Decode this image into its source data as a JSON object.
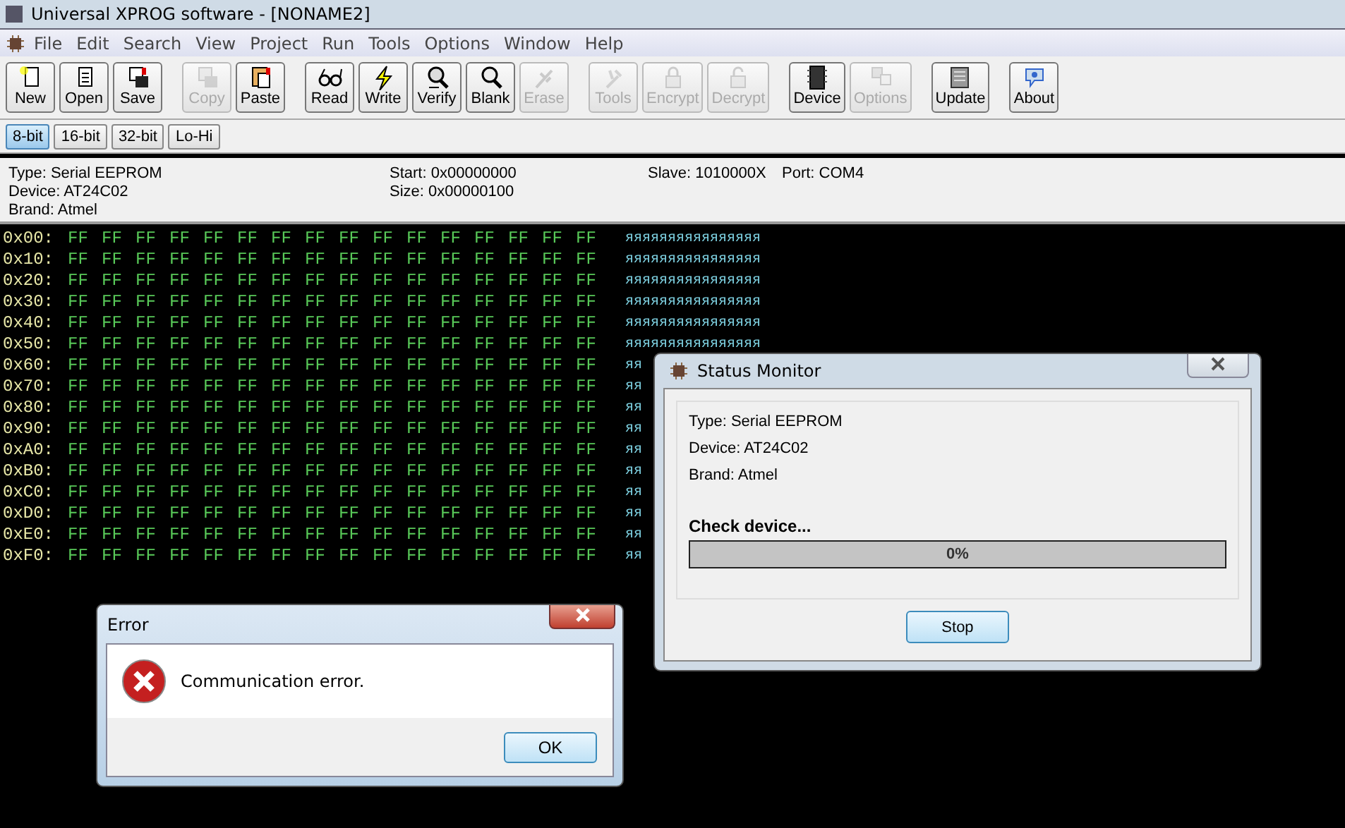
{
  "window": {
    "title": "Universal XPROG software - [NONAME2]"
  },
  "menu": [
    "File",
    "Edit",
    "Search",
    "View",
    "Project",
    "Run",
    "Tools",
    "Options",
    "Window",
    "Help"
  ],
  "toolbar": [
    [
      {
        "label": "New",
        "disabled": false
      },
      {
        "label": "Open",
        "disabled": false
      },
      {
        "label": "Save",
        "disabled": false
      }
    ],
    [
      {
        "label": "Copy",
        "disabled": true
      },
      {
        "label": "Paste",
        "disabled": false
      }
    ],
    [
      {
        "label": "Read",
        "disabled": false
      },
      {
        "label": "Write",
        "disabled": false
      },
      {
        "label": "Verify",
        "disabled": false
      },
      {
        "label": "Blank",
        "disabled": false
      },
      {
        "label": "Erase",
        "disabled": true
      }
    ],
    [
      {
        "label": "Tools",
        "disabled": true
      },
      {
        "label": "Encrypt",
        "disabled": true
      },
      {
        "label": "Decrypt",
        "disabled": true
      }
    ],
    [
      {
        "label": "Device",
        "disabled": false
      },
      {
        "label": "Options",
        "disabled": true
      }
    ],
    [
      {
        "label": "Update",
        "disabled": false
      }
    ],
    [
      {
        "label": "About",
        "disabled": false
      }
    ]
  ],
  "bit_tabs": [
    {
      "label": "8-bit",
      "selected": true
    },
    {
      "label": "16-bit",
      "selected": false
    },
    {
      "label": "32-bit",
      "selected": false
    },
    {
      "label": "Lo-Hi",
      "selected": false
    }
  ],
  "info": {
    "column_1": [
      "Type: Serial EEPROM",
      "Device: AT24C02",
      "Brand: Atmel"
    ],
    "column_2": [
      "Start: 0x00000000",
      "Size: 0x00000100"
    ],
    "column_3": [
      "Slave: 1010000X"
    ],
    "column_4": [
      "Port: COM4"
    ]
  },
  "hex_rows": [
    {
      "address": "0x00:",
      "bytes": [
        "FF",
        "FF",
        "FF",
        "FF",
        "FF",
        "FF",
        "FF",
        "FF",
        "FF",
        "FF",
        "FF",
        "FF",
        "FF",
        "FF",
        "FF",
        "FF"
      ],
      "ascii": "яяяяяяяяяяяяяяяя"
    },
    {
      "address": "0x10:",
      "bytes": [
        "FF",
        "FF",
        "FF",
        "FF",
        "FF",
        "FF",
        "FF",
        "FF",
        "FF",
        "FF",
        "FF",
        "FF",
        "FF",
        "FF",
        "FF",
        "FF"
      ],
      "ascii": "яяяяяяяяяяяяяяяя"
    },
    {
      "address": "0x20:",
      "bytes": [
        "FF",
        "FF",
        "FF",
        "FF",
        "FF",
        "FF",
        "FF",
        "FF",
        "FF",
        "FF",
        "FF",
        "FF",
        "FF",
        "FF",
        "FF",
        "FF"
      ],
      "ascii": "яяяяяяяяяяяяяяяя"
    },
    {
      "address": "0x30:",
      "bytes": [
        "FF",
        "FF",
        "FF",
        "FF",
        "FF",
        "FF",
        "FF",
        "FF",
        "FF",
        "FF",
        "FF",
        "FF",
        "FF",
        "FF",
        "FF",
        "FF"
      ],
      "ascii": "яяяяяяяяяяяяяяяя"
    },
    {
      "address": "0x40:",
      "bytes": [
        "FF",
        "FF",
        "FF",
        "FF",
        "FF",
        "FF",
        "FF",
        "FF",
        "FF",
        "FF",
        "FF",
        "FF",
        "FF",
        "FF",
        "FF",
        "FF"
      ],
      "ascii": "яяяяяяяяяяяяяяяя"
    },
    {
      "address": "0x50:",
      "bytes": [
        "FF",
        "FF",
        "FF",
        "FF",
        "FF",
        "FF",
        "FF",
        "FF",
        "FF",
        "FF",
        "FF",
        "FF",
        "FF",
        "FF",
        "FF",
        "FF"
      ],
      "ascii": "яяяяяяяяяяяяяяяя"
    },
    {
      "address": "0x60:",
      "bytes": [
        "FF",
        "FF",
        "FF",
        "FF",
        "FF",
        "FF",
        "FF",
        "FF",
        "FF",
        "FF",
        "FF",
        "FF",
        "FF",
        "FF",
        "FF",
        "FF"
      ],
      "ascii": "яя"
    },
    {
      "address": "0x70:",
      "bytes": [
        "FF",
        "FF",
        "FF",
        "FF",
        "FF",
        "FF",
        "FF",
        "FF",
        "FF",
        "FF",
        "FF",
        "FF",
        "FF",
        "FF",
        "FF",
        "FF"
      ],
      "ascii": "яя"
    },
    {
      "address": "0x80:",
      "bytes": [
        "FF",
        "FF",
        "FF",
        "FF",
        "FF",
        "FF",
        "FF",
        "FF",
        "FF",
        "FF",
        "FF",
        "FF",
        "FF",
        "FF",
        "FF",
        "FF"
      ],
      "ascii": "яя"
    },
    {
      "address": "0x90:",
      "bytes": [
        "FF",
        "FF",
        "FF",
        "FF",
        "FF",
        "FF",
        "FF",
        "FF",
        "FF",
        "FF",
        "FF",
        "FF",
        "FF",
        "FF",
        "FF",
        "FF"
      ],
      "ascii": "яя"
    },
    {
      "address": "0xA0:",
      "bytes": [
        "FF",
        "FF",
        "FF",
        "FF",
        "FF",
        "FF",
        "FF",
        "FF",
        "FF",
        "FF",
        "FF",
        "FF",
        "FF",
        "FF",
        "FF",
        "FF"
      ],
      "ascii": "яя"
    },
    {
      "address": "0xB0:",
      "bytes": [
        "FF",
        "FF",
        "FF",
        "FF",
        "FF",
        "FF",
        "FF",
        "FF",
        "FF",
        "FF",
        "FF",
        "FF",
        "FF",
        "FF",
        "FF",
        "FF"
      ],
      "ascii": "яя"
    },
    {
      "address": "0xC0:",
      "bytes": [
        "FF",
        "FF",
        "FF",
        "FF",
        "FF",
        "FF",
        "FF",
        "FF",
        "FF",
        "FF",
        "FF",
        "FF",
        "FF",
        "FF",
        "FF",
        "FF"
      ],
      "ascii": "яя"
    },
    {
      "address": "0xD0:",
      "bytes": [
        "FF",
        "FF",
        "FF",
        "FF",
        "FF",
        "FF",
        "FF",
        "FF",
        "FF",
        "FF",
        "FF",
        "FF",
        "FF",
        "FF",
        "FF",
        "FF"
      ],
      "ascii": "яя"
    },
    {
      "address": "0xE0:",
      "bytes": [
        "FF",
        "FF",
        "FF",
        "FF",
        "FF",
        "FF",
        "FF",
        "FF",
        "FF",
        "FF",
        "FF",
        "FF",
        "FF",
        "FF",
        "FF",
        "FF"
      ],
      "ascii": "яя"
    },
    {
      "address": "0xF0:",
      "bytes": [
        "FF",
        "FF",
        "FF",
        "FF",
        "FF",
        "FF",
        "FF",
        "FF",
        "FF",
        "FF",
        "FF",
        "FF",
        "FF",
        "FF",
        "FF",
        "FF"
      ],
      "ascii": "яя"
    }
  ],
  "status_monitor": {
    "title": "Status Monitor",
    "lines": [
      "Type: Serial EEPROM",
      "Device: AT24C02",
      "Brand: Atmel"
    ],
    "task": "Check device...",
    "progress": {
      "level": 0,
      "reading": "0%"
    },
    "button": "Stop"
  },
  "error_dialog": {
    "title": "Error",
    "message": "Communication error.",
    "button": "OK"
  }
}
